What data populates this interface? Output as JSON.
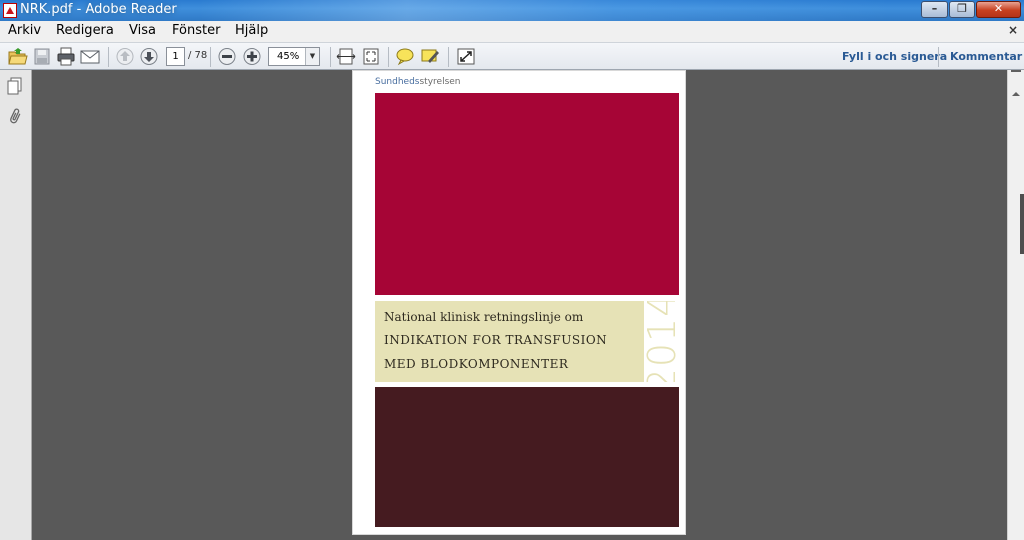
{
  "window": {
    "title": "NRK.pdf - Adobe Reader"
  },
  "menu": {
    "items": [
      "Arkiv",
      "Redigera",
      "Visa",
      "Fönster",
      "Hjälp"
    ],
    "close_glyph": "×"
  },
  "toolbar": {
    "page_current": "1",
    "page_total": "/ 78",
    "zoom": "45%",
    "fill_sign_label": "Fyll i och signera",
    "comment_label": "Kommentar",
    "icons": [
      "open-folder-icon",
      "save-icon",
      "print-icon",
      "email-icon",
      "prev-page-icon",
      "next-page-icon",
      "zoom-out-icon",
      "zoom-in-icon",
      "fit-width-icon",
      "fit-page-icon",
      "comment-bubble-icon",
      "highlight-icon",
      "fullscreen-icon"
    ]
  },
  "document": {
    "logo_part1": "Sundheds",
    "logo_part2": "styrelsen",
    "subtitle": "National klinisk retningslinje om",
    "title_line1": "INDIKATION FOR TRANSFUSION",
    "title_line2": "MED BLODKOMPONENTER",
    "year": "2014",
    "colors": {
      "top_band": "#a60536",
      "middle_band": "#e6e2b6",
      "bottom_band": "#451b20"
    }
  }
}
